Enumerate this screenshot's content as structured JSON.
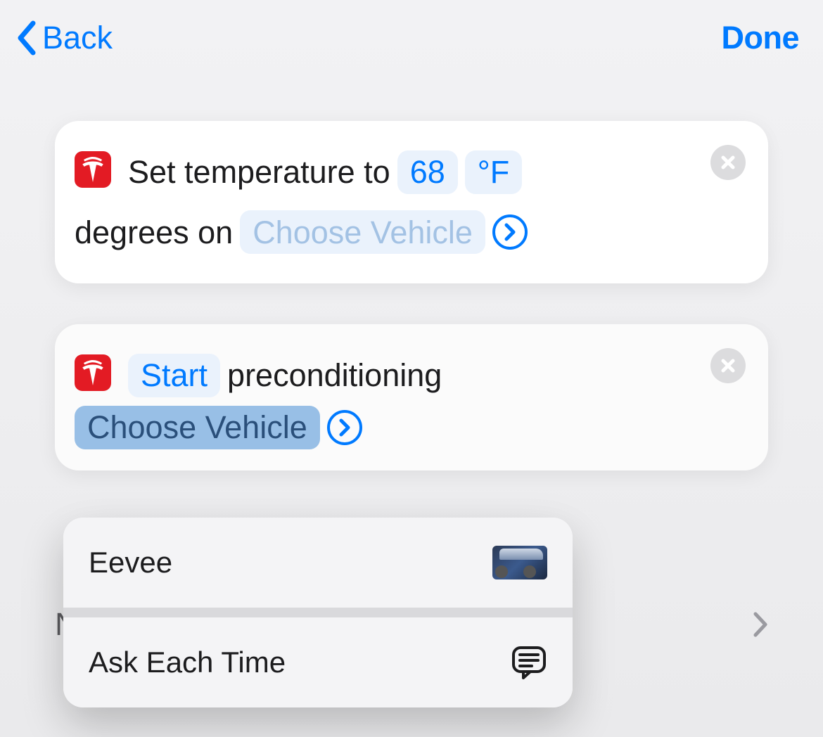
{
  "nav": {
    "back_label": "Back",
    "done_label": "Done"
  },
  "actions": [
    {
      "app_icon": "tesla-icon",
      "text1": "Set temperature to",
      "temp_value": "68",
      "temp_unit": "°F",
      "text2": "degrees on",
      "vehicle_placeholder": "Choose Vehicle"
    },
    {
      "app_icon": "tesla-icon",
      "mode_value": "Start",
      "text1": "preconditioning",
      "vehicle_placeholder": "Choose Vehicle"
    }
  ],
  "popover": {
    "items": [
      {
        "label": "Eevee",
        "icon": "car"
      },
      {
        "label": "Ask Each Time",
        "icon": "prompt"
      }
    ]
  },
  "bg_row": {
    "leading_letter": "N"
  },
  "colors": {
    "ios_blue": "#007aff",
    "tesla_red": "#e31b24",
    "pill_bg": "#eaf2fc",
    "pill_placeholder_text": "#a3c2e4",
    "pill_selected_bg": "#98bfe6",
    "close_bg": "#dcdcde"
  }
}
